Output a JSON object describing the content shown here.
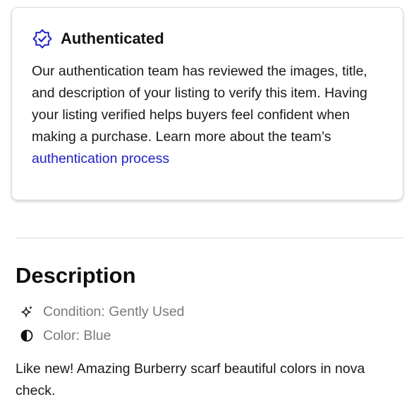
{
  "auth_card": {
    "icon": "verified-badge-icon",
    "title": "Authenticated",
    "body_text": "Our authentication team has reviewed the images, title, and description of your listing to verify this item. Having your listing verified helps buyers feel confident when making a purchase. Learn more about the team’s",
    "link_text": "authentication process"
  },
  "description": {
    "heading": "Description",
    "details": [
      {
        "icon": "sparkle-icon",
        "text": "Condition: Gently Used"
      },
      {
        "icon": "half-circle-icon",
        "text": "Color: Blue"
      }
    ],
    "text": "Like new! Amazing Burberry scarf beautiful colors in nova check."
  },
  "colors": {
    "accent": "#1f22c4",
    "muted_text": "#7a7a7a",
    "divider": "#dcdcdc"
  }
}
